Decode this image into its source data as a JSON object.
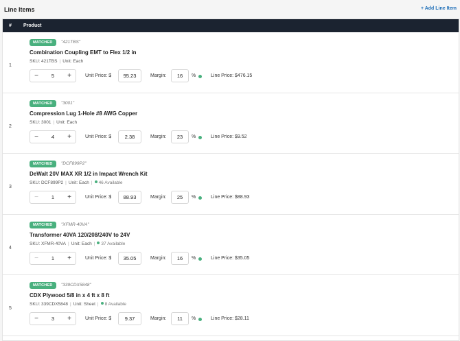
{
  "header": {
    "title": "Line Items",
    "add_label": "+ Add Line Item"
  },
  "table": {
    "col_num": "#",
    "col_product": "Product"
  },
  "labels": {
    "unit_price": "Unit Price: $",
    "margin": "Margin:",
    "percent": "%",
    "sku_prefix": "SKU:",
    "unit_prefix": "Unit:"
  },
  "rows": [
    {
      "num": "1",
      "status": "MATCHED",
      "code": "\"421TBS\"",
      "name": "Combination Coupling EMT to Flex 1/2 in",
      "sku": "421TBS",
      "unit": "Each",
      "available": "",
      "qty": "5",
      "unit_price": "95.23",
      "margin": "16",
      "line_price": "Line Price: $476.15"
    },
    {
      "num": "2",
      "status": "MATCHED",
      "code": "\"3001\"",
      "name": "Compression Lug 1-Hole #8 AWG Copper",
      "sku": "3001",
      "unit": "Each",
      "available": "",
      "qty": "4",
      "unit_price": "2.38",
      "margin": "23",
      "line_price": "Line Price: $9.52"
    },
    {
      "num": "3",
      "status": "MATCHED",
      "code": "\"DCF899P2\"",
      "name": "DeWalt 20V MAX XR 1/2 in Impact Wrench Kit",
      "sku": "DCF899P2",
      "unit": "Each",
      "available": "46 Available",
      "qty": "1",
      "unit_price": "88.93",
      "margin": "25",
      "line_price": "Line Price: $88.93"
    },
    {
      "num": "4",
      "status": "MATCHED",
      "code": "\"XFMR-40VA\"",
      "name": "Transformer 40VA 120/208/240V to 24V",
      "sku": "XFMR-40VA",
      "unit": "Each",
      "available": "37 Available",
      "qty": "1",
      "unit_price": "35.05",
      "margin": "16",
      "line_price": "Line Price: $35.05"
    },
    {
      "num": "5",
      "status": "MATCHED",
      "code": "\"339CDX5848\"",
      "name": "CDX Plywood 5/8 in x 4 ft x 8 ft",
      "sku": "339CDX5848",
      "unit": "Sheet",
      "available": "8 Available",
      "qty": "3",
      "unit_price": "9.37",
      "margin": "11",
      "line_price": "Line Price: $28.11"
    }
  ],
  "colors": {
    "accent": "#1f6fb8",
    "matched": "#49b07e",
    "header_bg": "#1b2330"
  }
}
